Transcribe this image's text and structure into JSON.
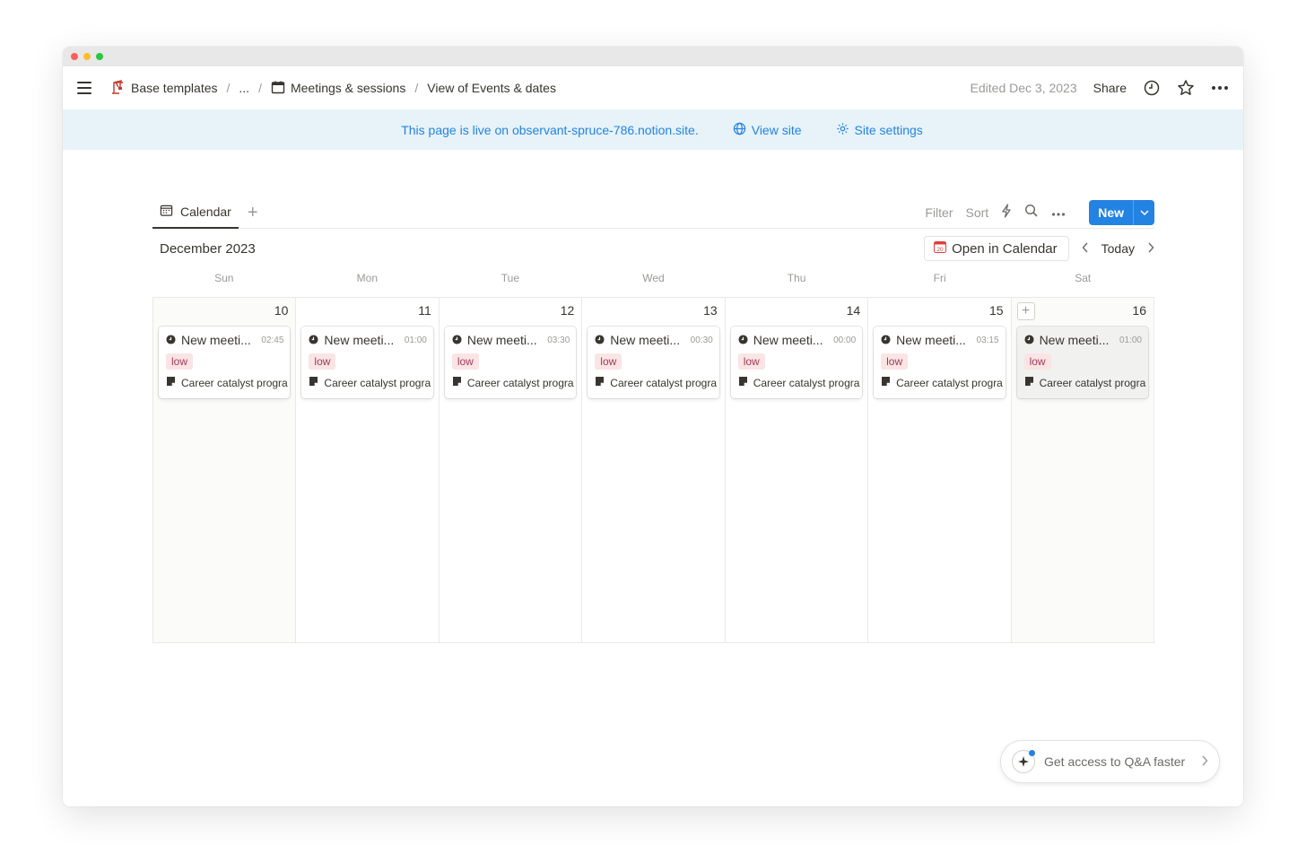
{
  "titlebar": {
    "colors": [
      "#ff5f57",
      "#febc2e",
      "#28c840"
    ]
  },
  "breadcrumb": {
    "items": [
      {
        "label": "Base templates",
        "icon": "crane-icon"
      },
      {
        "label": "..."
      },
      {
        "label": "Meetings & sessions",
        "icon": "calendar-icon"
      },
      {
        "label": "View of Events & dates"
      }
    ]
  },
  "topbar": {
    "edited": "Edited Dec 3, 2023",
    "share": "Share"
  },
  "banner": {
    "text": "This page is live on observant-spruce-786.notion.site.",
    "view_site": "View site",
    "site_settings": "Site settings"
  },
  "view": {
    "tab_label": "Calendar",
    "filter": "Filter",
    "sort": "Sort",
    "new_label": "New"
  },
  "calendar": {
    "month": "December 2023",
    "open_in_calendar": "Open in Calendar",
    "today": "Today",
    "weekdays": [
      "Sun",
      "Mon",
      "Tue",
      "Wed",
      "Thu",
      "Fri",
      "Sat"
    ],
    "days": [
      {
        "num": "10",
        "title": "New meeti...",
        "time": "02:45",
        "tag": "low",
        "relation": "Career catalyst progra"
      },
      {
        "num": "11",
        "title": "New meeti...",
        "time": "01:00",
        "tag": "low",
        "relation": "Career catalyst progra"
      },
      {
        "num": "12",
        "title": "New meeti...",
        "time": "03:30",
        "tag": "low",
        "relation": "Career catalyst progra"
      },
      {
        "num": "13",
        "title": "New meeti...",
        "time": "00:30",
        "tag": "low",
        "relation": "Career catalyst progra"
      },
      {
        "num": "14",
        "title": "New meeti...",
        "time": "00:00",
        "tag": "low",
        "relation": "Career catalyst progra"
      },
      {
        "num": "15",
        "title": "New meeti...",
        "time": "03:15",
        "tag": "low",
        "relation": "Career catalyst progra"
      },
      {
        "num": "16",
        "title": "New meeti...",
        "time": "01:00",
        "tag": "low",
        "relation": "Career catalyst progra"
      }
    ]
  },
  "qa_button": {
    "label": "Get access to Q&A faster"
  },
  "colors": {
    "accent": "#2383e2",
    "tag_bg": "#fbe4e4",
    "banner_bg": "#e7f3f8"
  }
}
